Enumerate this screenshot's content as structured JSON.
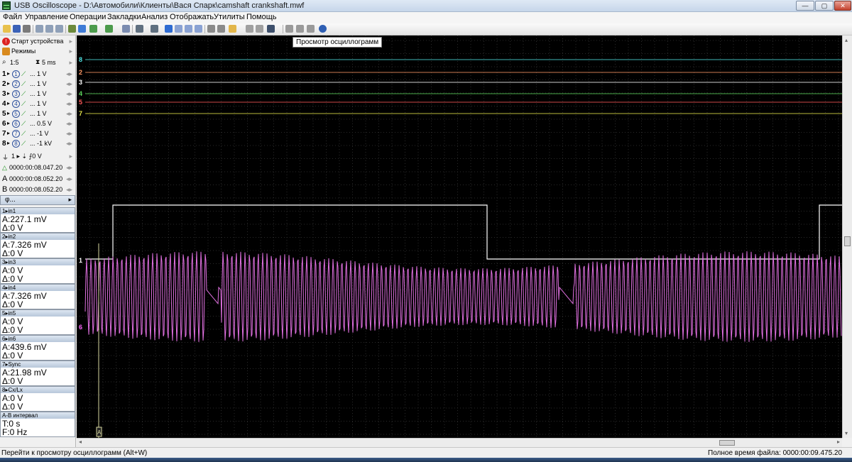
{
  "window": {
    "title": "USB Oscilloscope - D:\\Автомобили\\Клиенты\\Вася Спарк\\camshaft crankshaft.mwf",
    "min": "—",
    "max": "▢",
    "close": "✕"
  },
  "menu": [
    "Файл",
    "Управление",
    "Операции",
    "Закладки",
    "Анализ",
    "Отображать",
    "Утилиты",
    "Помощь"
  ],
  "tooltip": "Просмотр осциллограмм",
  "sidebar": {
    "start_device": "Старт устройства",
    "modes": "Режимы",
    "zoom": "1:5",
    "timebase": "5 ms",
    "channels": [
      {
        "num": "1",
        "circ": "1",
        "scale": "... 1 V"
      },
      {
        "num": "2",
        "circ": "2",
        "scale": "... 1 V"
      },
      {
        "num": "3",
        "circ": "3",
        "scale": "... 1 V"
      },
      {
        "num": "4",
        "circ": "4",
        "scale": "... 1 V"
      },
      {
        "num": "5",
        "circ": "5",
        "scale": "... 1 V"
      },
      {
        "num": "6",
        "circ": "6",
        "scale": "... 0.5 V"
      },
      {
        "num": "7",
        "circ": "7",
        "scale": "... -1 V"
      },
      {
        "num": "8",
        "circ": "8",
        "scale": "... -1 kV"
      }
    ],
    "trigger": "1 ▸ ⇣ ⨍0 V",
    "cursor_time": "0000:00:08.047.20",
    "cursor_a": "0000:00:08.052.20",
    "cursor_b": "0000:00:08.052.20",
    "phi": "φ..."
  },
  "measurements": [
    {
      "head": "1▸in1",
      "a": "A:227.1 mV",
      "d": "Δ:0 V"
    },
    {
      "head": "2▸in2",
      "a": "A:7.326 mV",
      "d": "Δ:0 V"
    },
    {
      "head": "3▸in3",
      "a": "A:0 V",
      "d": "Δ:0 V"
    },
    {
      "head": "4▸in4",
      "a": "A:7.326 mV",
      "d": "Δ:0 V"
    },
    {
      "head": "5▸in5",
      "a": "A:0 V",
      "d": "Δ:0 V"
    },
    {
      "head": "6▸in6",
      "a": "A:439.6 mV",
      "d": "Δ:0 V"
    },
    {
      "head": "7▸Sync",
      "a": "A:21.98 mV",
      "d": "Δ:0 V"
    },
    {
      "head": "8▸Cx/Lx",
      "a": "A:0 V",
      "d": "Δ:0 V"
    },
    {
      "head": "A-B интервал",
      "a": "T:0 s",
      "d": "F:0 Hz"
    }
  ],
  "scope": {
    "markers": [
      {
        "label": "8",
        "color": "#4fe3e3"
      },
      {
        "label": "2",
        "color": "#ff9966"
      },
      {
        "label": "3",
        "color": "#ffffff"
      },
      {
        "label": "4",
        "color": "#5dd55d"
      },
      {
        "label": "5",
        "color": "#ff5a5a"
      },
      {
        "label": "7",
        "color": "#e8e84a"
      },
      {
        "label": "1",
        "color": "#ffffff"
      },
      {
        "label": "6",
        "color": "#ff66ff"
      }
    ],
    "cursor_label": "A"
  },
  "status": {
    "left": "Перейти к просмотру осциллограмм (Alt+W)",
    "right": "Полное время файла: 0000:00:09.475.20"
  }
}
